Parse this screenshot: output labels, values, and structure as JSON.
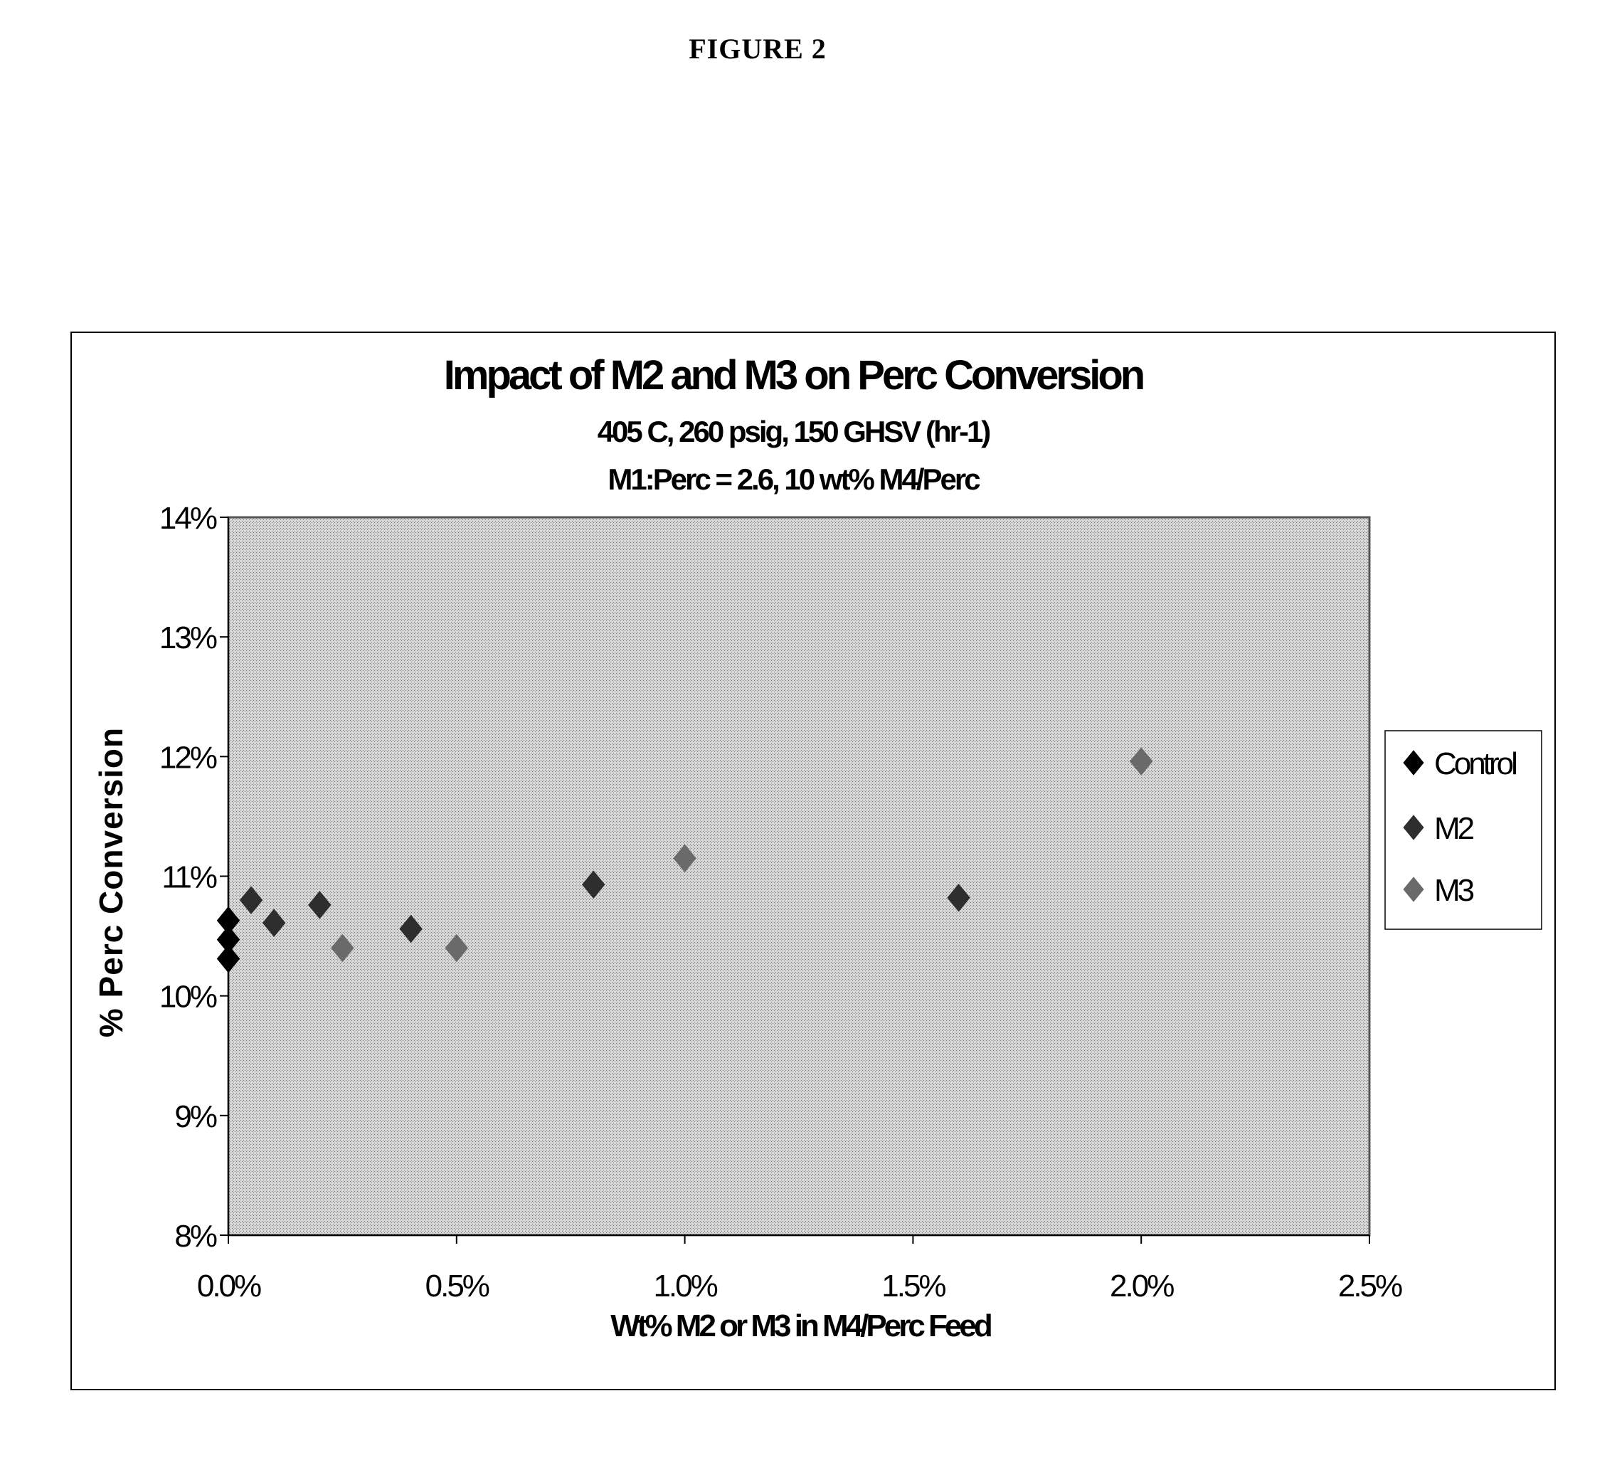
{
  "figure_label": "FIGURE 2",
  "chart_data": {
    "type": "scatter",
    "title": "Impact of M2 and M3 on Perc Conversion",
    "subtitle_lines": [
      "405 C, 260 psig, 150 GHSV (hr-1)",
      "M1:Perc = 2.6, 10 wt% M4/Perc"
    ],
    "xlabel": "Wt% M2 or M3 in M4/Perc Feed",
    "ylabel": "% Perc Conversion",
    "xlim": [
      0.0,
      2.5
    ],
    "ylim": [
      8,
      14
    ],
    "x_unit": "%",
    "y_unit": "%",
    "x_ticks": [
      0.0,
      0.5,
      1.0,
      1.5,
      2.0,
      2.5
    ],
    "x_tick_labels": [
      "0.0%",
      "0.5%",
      "1.0%",
      "1.5%",
      "2.0%",
      "2.5%"
    ],
    "y_ticks": [
      8,
      9,
      10,
      11,
      12,
      13,
      14
    ],
    "y_tick_labels": [
      "8%",
      "9%",
      "10%",
      "11%",
      "12%",
      "13%",
      "14%"
    ],
    "grid": false,
    "plot_background": "#c8c8c8",
    "legend_position": "right",
    "series": [
      {
        "name": "Control",
        "marker": "diamond",
        "color": "#000000",
        "points": [
          {
            "x": 0.0,
            "y": 10.63
          },
          {
            "x": 0.0,
            "y": 10.47
          },
          {
            "x": 0.0,
            "y": 10.31
          }
        ]
      },
      {
        "name": "M2",
        "marker": "diamond",
        "color": "#2e2e2e",
        "points": [
          {
            "x": 0.05,
            "y": 10.8
          },
          {
            "x": 0.1,
            "y": 10.61
          },
          {
            "x": 0.2,
            "y": 10.76
          },
          {
            "x": 0.4,
            "y": 10.56
          },
          {
            "x": 0.8,
            "y": 10.93
          },
          {
            "x": 1.6,
            "y": 10.82
          }
        ]
      },
      {
        "name": "M3",
        "marker": "diamond",
        "color": "#6a6a6a",
        "points": [
          {
            "x": 0.25,
            "y": 10.4
          },
          {
            "x": 0.5,
            "y": 10.4
          },
          {
            "x": 1.0,
            "y": 11.15
          },
          {
            "x": 2.0,
            "y": 11.96
          }
        ]
      }
    ]
  }
}
